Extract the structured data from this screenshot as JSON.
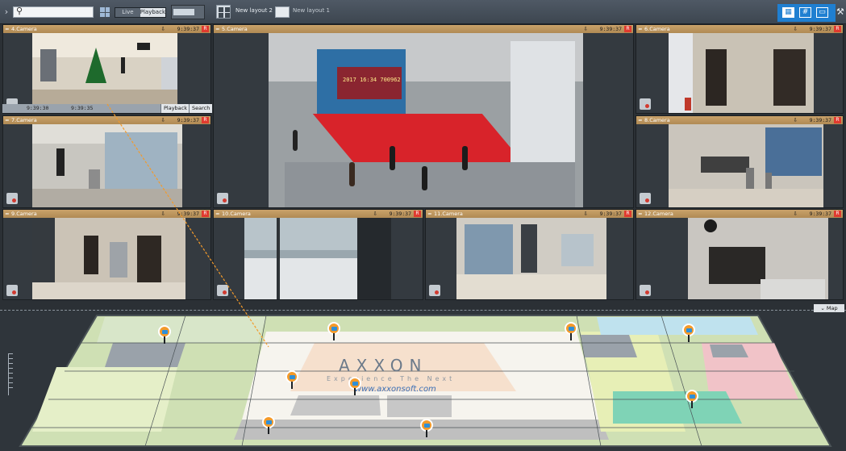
{
  "topbar": {
    "search": {
      "placeholder": ""
    },
    "mode": {
      "live": "Live",
      "playback": "Playback",
      "selected": "playback"
    },
    "layouts": [
      {
        "label": "New layout 2",
        "active": true
      },
      {
        "label": "New layout 1",
        "active": false
      }
    ],
    "view_buttons": [
      "grid-view",
      "sparse-grid-view",
      "single-view"
    ],
    "icons": {
      "search": "search-icon",
      "expand": "chevron-right-icon",
      "tools": "tools-icon"
    }
  },
  "cameras": [
    {
      "name": "4.Camera",
      "time": "9:39:37",
      "rec": "R"
    },
    {
      "name": "5.Camera",
      "time": "9:39:37",
      "rec": "R"
    },
    {
      "name": "6.Camera",
      "time": "9:39:37",
      "rec": "R"
    },
    {
      "name": "7.Camera",
      "time": "9:39:37",
      "rec": "R"
    },
    {
      "name": "8.Camera",
      "time": "9:39:37",
      "rec": "R"
    },
    {
      "name": "9.Camera",
      "time": "9:39:37",
      "rec": "R"
    },
    {
      "name": "10.Camera",
      "time": "9:39:37",
      "rec": "R"
    },
    {
      "name": "11.Camera",
      "time": "9:39:37",
      "rec": "R"
    },
    {
      "name": "12.Camera",
      "time": "9:39:37",
      "rec": "R"
    }
  ],
  "playback_strip": {
    "time1": "9:39:30",
    "time2": "9:39:35",
    "playback_label": "Playback",
    "search_label": "Search"
  },
  "screen_text": {
    "board": "2017 16:34 700962"
  },
  "map": {
    "label": "Map",
    "brand": "AXXON",
    "tagline": "Experience The Next",
    "url": "www.axxonsoft.com",
    "pin_count": 9
  },
  "colors": {
    "accent": "#1f7fd1",
    "header": "#c9a26a",
    "rec": "#e03a2f",
    "pin": "#f39a2a",
    "carpet": "#d8232a"
  }
}
